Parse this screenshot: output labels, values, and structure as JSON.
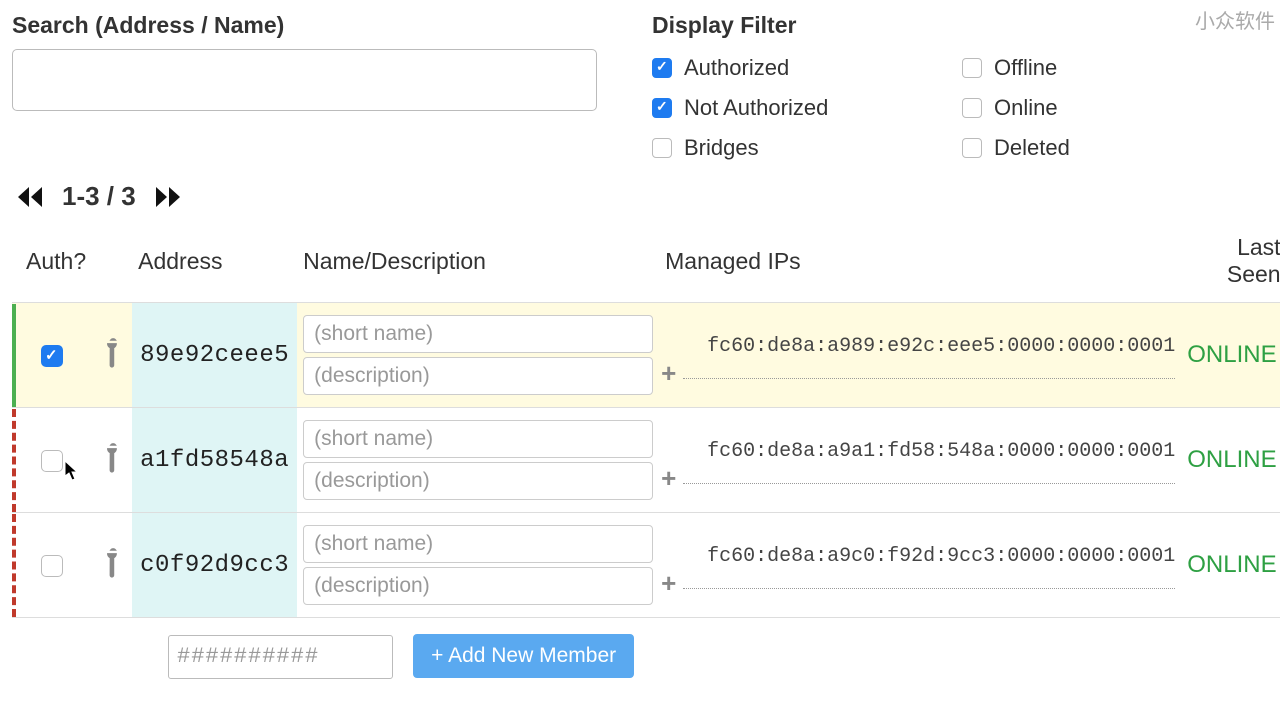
{
  "watermark": "小众软件",
  "search": {
    "label": "Search (Address / Name)",
    "value": ""
  },
  "filter": {
    "label": "Display Filter",
    "options": {
      "authorized": {
        "label": "Authorized",
        "checked": true
      },
      "not_authorized": {
        "label": "Not Authorized",
        "checked": true
      },
      "bridges": {
        "label": "Bridges",
        "checked": false
      },
      "offline": {
        "label": "Offline",
        "checked": false
      },
      "online": {
        "label": "Online",
        "checked": false
      },
      "deleted": {
        "label": "Deleted",
        "checked": false
      }
    }
  },
  "pager": {
    "range": "1-3 / 3"
  },
  "columns": {
    "auth": "Auth?",
    "address": "Address",
    "name": "Name/Description",
    "ips": "Managed IPs",
    "last_seen": "Last Seen"
  },
  "placeholders": {
    "short_name": "(short name)",
    "description": "(description)",
    "new_member": "##########"
  },
  "rows": [
    {
      "auth": true,
      "address": "89e92ceee5",
      "short_name": "",
      "description": "",
      "ip": "fc60:de8a:a989:e92c:eee5:0000:0000:0001",
      "last_seen": "ONLINE"
    },
    {
      "auth": false,
      "address": "a1fd58548a",
      "short_name": "",
      "description": "",
      "ip": "fc60:de8a:a9a1:fd58:548a:0000:0000:0001",
      "last_seen": "ONLINE"
    },
    {
      "auth": false,
      "address": "c0f92d9cc3",
      "short_name": "",
      "description": "",
      "ip": "fc60:de8a:a9c0:f92d:9cc3:0000:0000:0001",
      "last_seen": "ONLINE"
    }
  ],
  "add_button": "+ Add New Member"
}
